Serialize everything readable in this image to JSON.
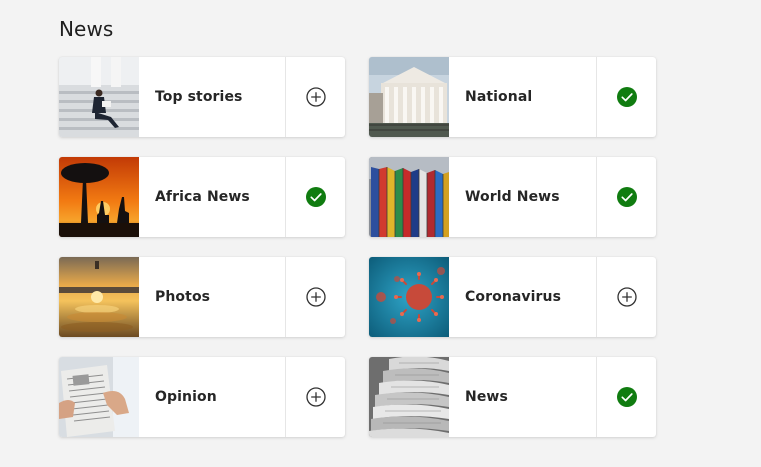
{
  "section": {
    "title": "News"
  },
  "cards": [
    {
      "label": "Top stories",
      "followed": false,
      "thumb": "businessman-on-steps"
    },
    {
      "label": "National",
      "followed": true,
      "thumb": "parliament-building"
    },
    {
      "label": "Africa News",
      "followed": true,
      "thumb": "savanna-sunset-giraffes"
    },
    {
      "label": "World News",
      "followed": true,
      "thumb": "flags-row"
    },
    {
      "label": "Photos",
      "followed": false,
      "thumb": "sunset-water-reflection"
    },
    {
      "label": "Coronavirus",
      "followed": false,
      "thumb": "virus-particles"
    },
    {
      "label": "Opinion",
      "followed": false,
      "thumb": "man-reading-newspaper"
    },
    {
      "label": "News",
      "followed": true,
      "thumb": "newspaper-stack"
    }
  ],
  "colors": {
    "followed_check": "#107c10",
    "add_icon": "#333333"
  }
}
